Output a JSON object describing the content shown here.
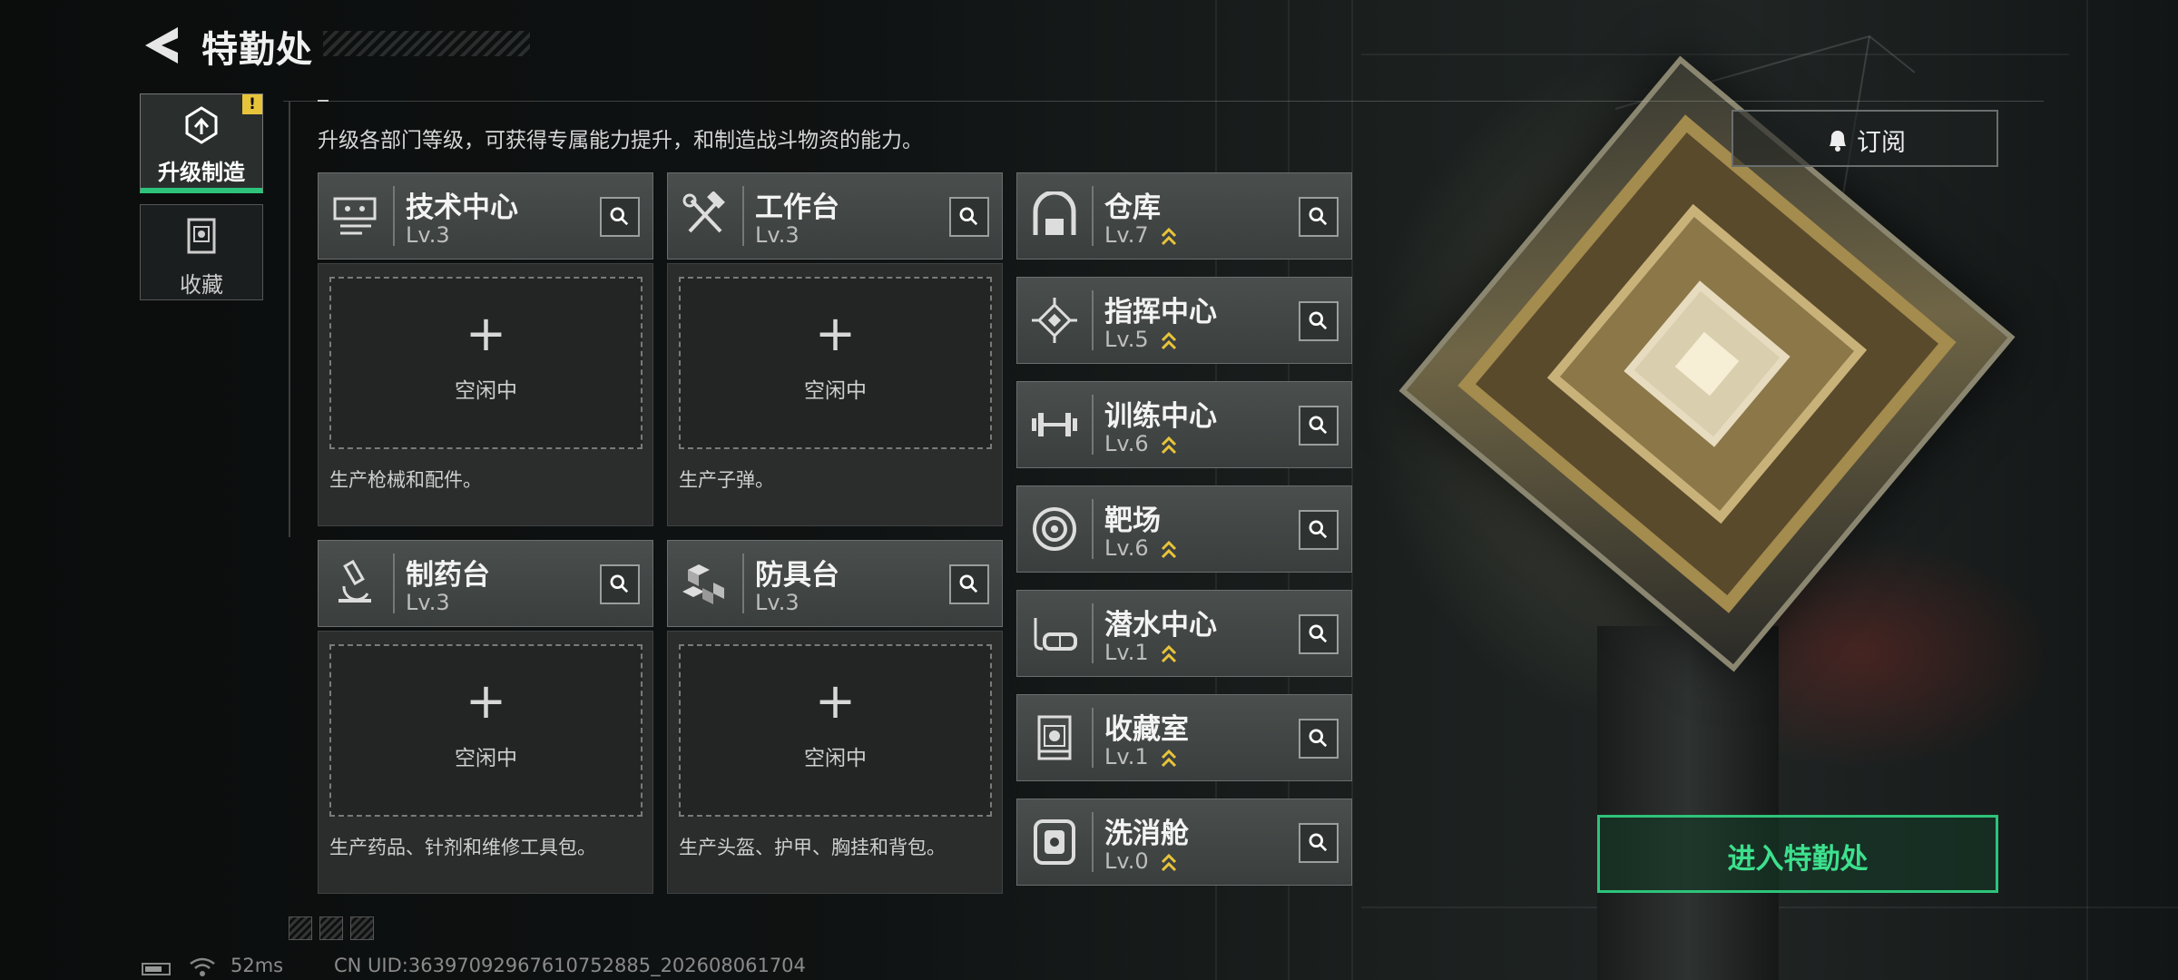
{
  "header": {
    "title": "特勤处"
  },
  "sidebar": {
    "tabs": [
      {
        "label": "升级制造",
        "badge": "!",
        "active": true,
        "icon": "upgrade-icon"
      },
      {
        "label": "收藏",
        "active": false,
        "icon": "collection-icon"
      }
    ]
  },
  "intro": "升级各部门等级，可获得专属能力提升，和制造战斗物资的能力。",
  "production": [
    {
      "name": "技术中心",
      "level": "Lv.3",
      "icon": "tech-center-icon",
      "slot_plus": "+",
      "slot_status": "空闲中",
      "desc": "生产枪械和配件。"
    },
    {
      "name": "工作台",
      "level": "Lv.3",
      "icon": "hammer-wrench-icon",
      "slot_plus": "+",
      "slot_status": "空闲中",
      "desc": "生产子弹。"
    },
    {
      "name": "制药台",
      "level": "Lv.3",
      "icon": "microscope-icon",
      "slot_plus": "+",
      "slot_status": "空闲中",
      "desc": "生产药品、针剂和维修工具包。"
    },
    {
      "name": "防具台",
      "level": "Lv.3",
      "icon": "cubes-icon",
      "slot_plus": "+",
      "slot_status": "空闲中",
      "desc": "生产头盔、护甲、胸挂和背包。"
    }
  ],
  "departments": [
    {
      "name": "仓库",
      "level": "Lv.7",
      "icon": "warehouse-icon",
      "upgradable": true
    },
    {
      "name": "指挥中心",
      "level": "Lv.5",
      "icon": "chip-icon",
      "upgradable": true
    },
    {
      "name": "训练中心",
      "level": "Lv.6",
      "icon": "dumbbell-icon",
      "upgradable": true
    },
    {
      "name": "靶场",
      "level": "Lv.6",
      "icon": "target-icon",
      "upgradable": true
    },
    {
      "name": "潜水中心",
      "level": "Lv.1",
      "icon": "diving-mask-icon",
      "upgradable": true
    },
    {
      "name": "收藏室",
      "level": "Lv.1",
      "icon": "display-case-icon",
      "upgradable": true
    },
    {
      "name": "洗消舱",
      "level": "Lv.0",
      "icon": "decon-pod-icon",
      "upgradable": true
    }
  ],
  "buttons": {
    "subscribe": "订阅",
    "enter": "进入特勤处"
  },
  "status": {
    "ping": "52ms",
    "uid": "CN UID:36397092967610752885_202608061704"
  },
  "colors": {
    "accent_green": "#2ec37a",
    "upgrade_arrow": "#e8c43a",
    "badge": "#e8c43a"
  }
}
